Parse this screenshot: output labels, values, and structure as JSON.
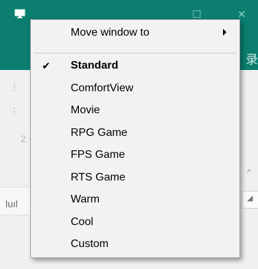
{
  "window": {
    "title_controls": [
      "—",
      "☐",
      "✕"
    ],
    "ribbon_text": "录"
  },
  "background": {
    "ruler_text": "luıl",
    "scroll_up": "^",
    "side_arrow": "◢"
  },
  "menu": {
    "move_window": {
      "label": "Move window to"
    },
    "items": [
      {
        "label": "Standard",
        "checked": true
      },
      {
        "label": "ComfortView"
      },
      {
        "label": "Movie"
      },
      {
        "label": "RPG Game"
      },
      {
        "label": "FPS Game"
      },
      {
        "label": "RTS Game"
      },
      {
        "label": "Warm"
      },
      {
        "label": "Cool"
      },
      {
        "label": "Custom"
      }
    ],
    "check_glyph": "✔"
  }
}
